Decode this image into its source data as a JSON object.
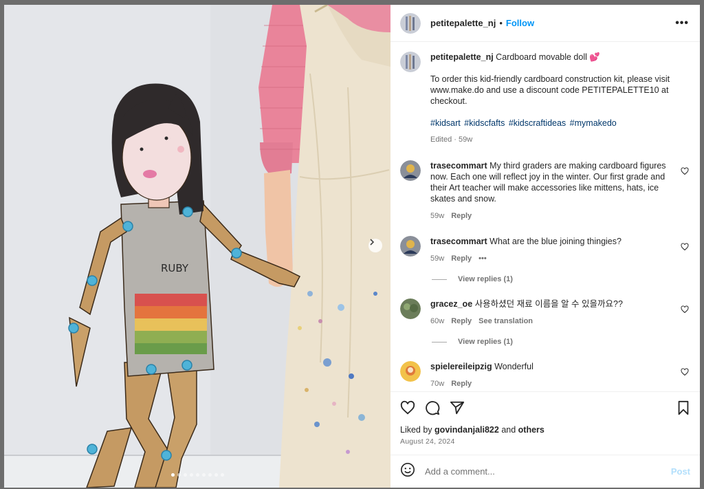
{
  "post": {
    "username": "petitepalette_nj",
    "follow_label": "Follow",
    "separator": "•",
    "more_label": "•••",
    "caption": {
      "title": "Cardboard movable doll",
      "emoji": "💕",
      "body": "To order this kid-friendly cardboard construction kit, please visit www.make.do and use a discount code PETITEPALETTE10 at checkout.",
      "hashtags": [
        "#kidsart",
        "#kidscfafts",
        "#kidscraftideas",
        "#mymakedo"
      ],
      "edited": "Edited · 59w"
    },
    "doll_label": "RUBY",
    "carousel": {
      "count": 9,
      "active_index": 0
    }
  },
  "comments": [
    {
      "username": "trasecommart",
      "text": "My third graders are making cardboard figures now. Each one will reflect joy in the winter. Our first grade and their Art teacher will make accessories like mittens, hats, ice skates and snow.",
      "time": "59w",
      "reply": "Reply"
    },
    {
      "username": "trasecommart",
      "text": "What are the blue joining thingies?",
      "time": "59w",
      "reply": "Reply",
      "more": "•••",
      "view_replies": "View replies (1)"
    },
    {
      "username": "gracez_oe",
      "text": "사용하셨던 재료 이름을 알 수 있을까요??",
      "time": "60w",
      "reply": "Reply",
      "translate": "See translation",
      "view_replies": "View replies (1)"
    },
    {
      "username": "spielereileipzig",
      "text": "Wonderful",
      "time": "70w",
      "reply": "Reply"
    }
  ],
  "footer": {
    "liked_prefix": "Liked by",
    "liked_user": "govindanjali822",
    "liked_and": "and",
    "liked_others": "others",
    "date": "August 24, 2024",
    "comment_placeholder": "Add a comment...",
    "post_label": "Post"
  },
  "colors": {
    "accent": "#0095f6",
    "post_disabled": "#b2dffc",
    "muted": "#737373"
  }
}
